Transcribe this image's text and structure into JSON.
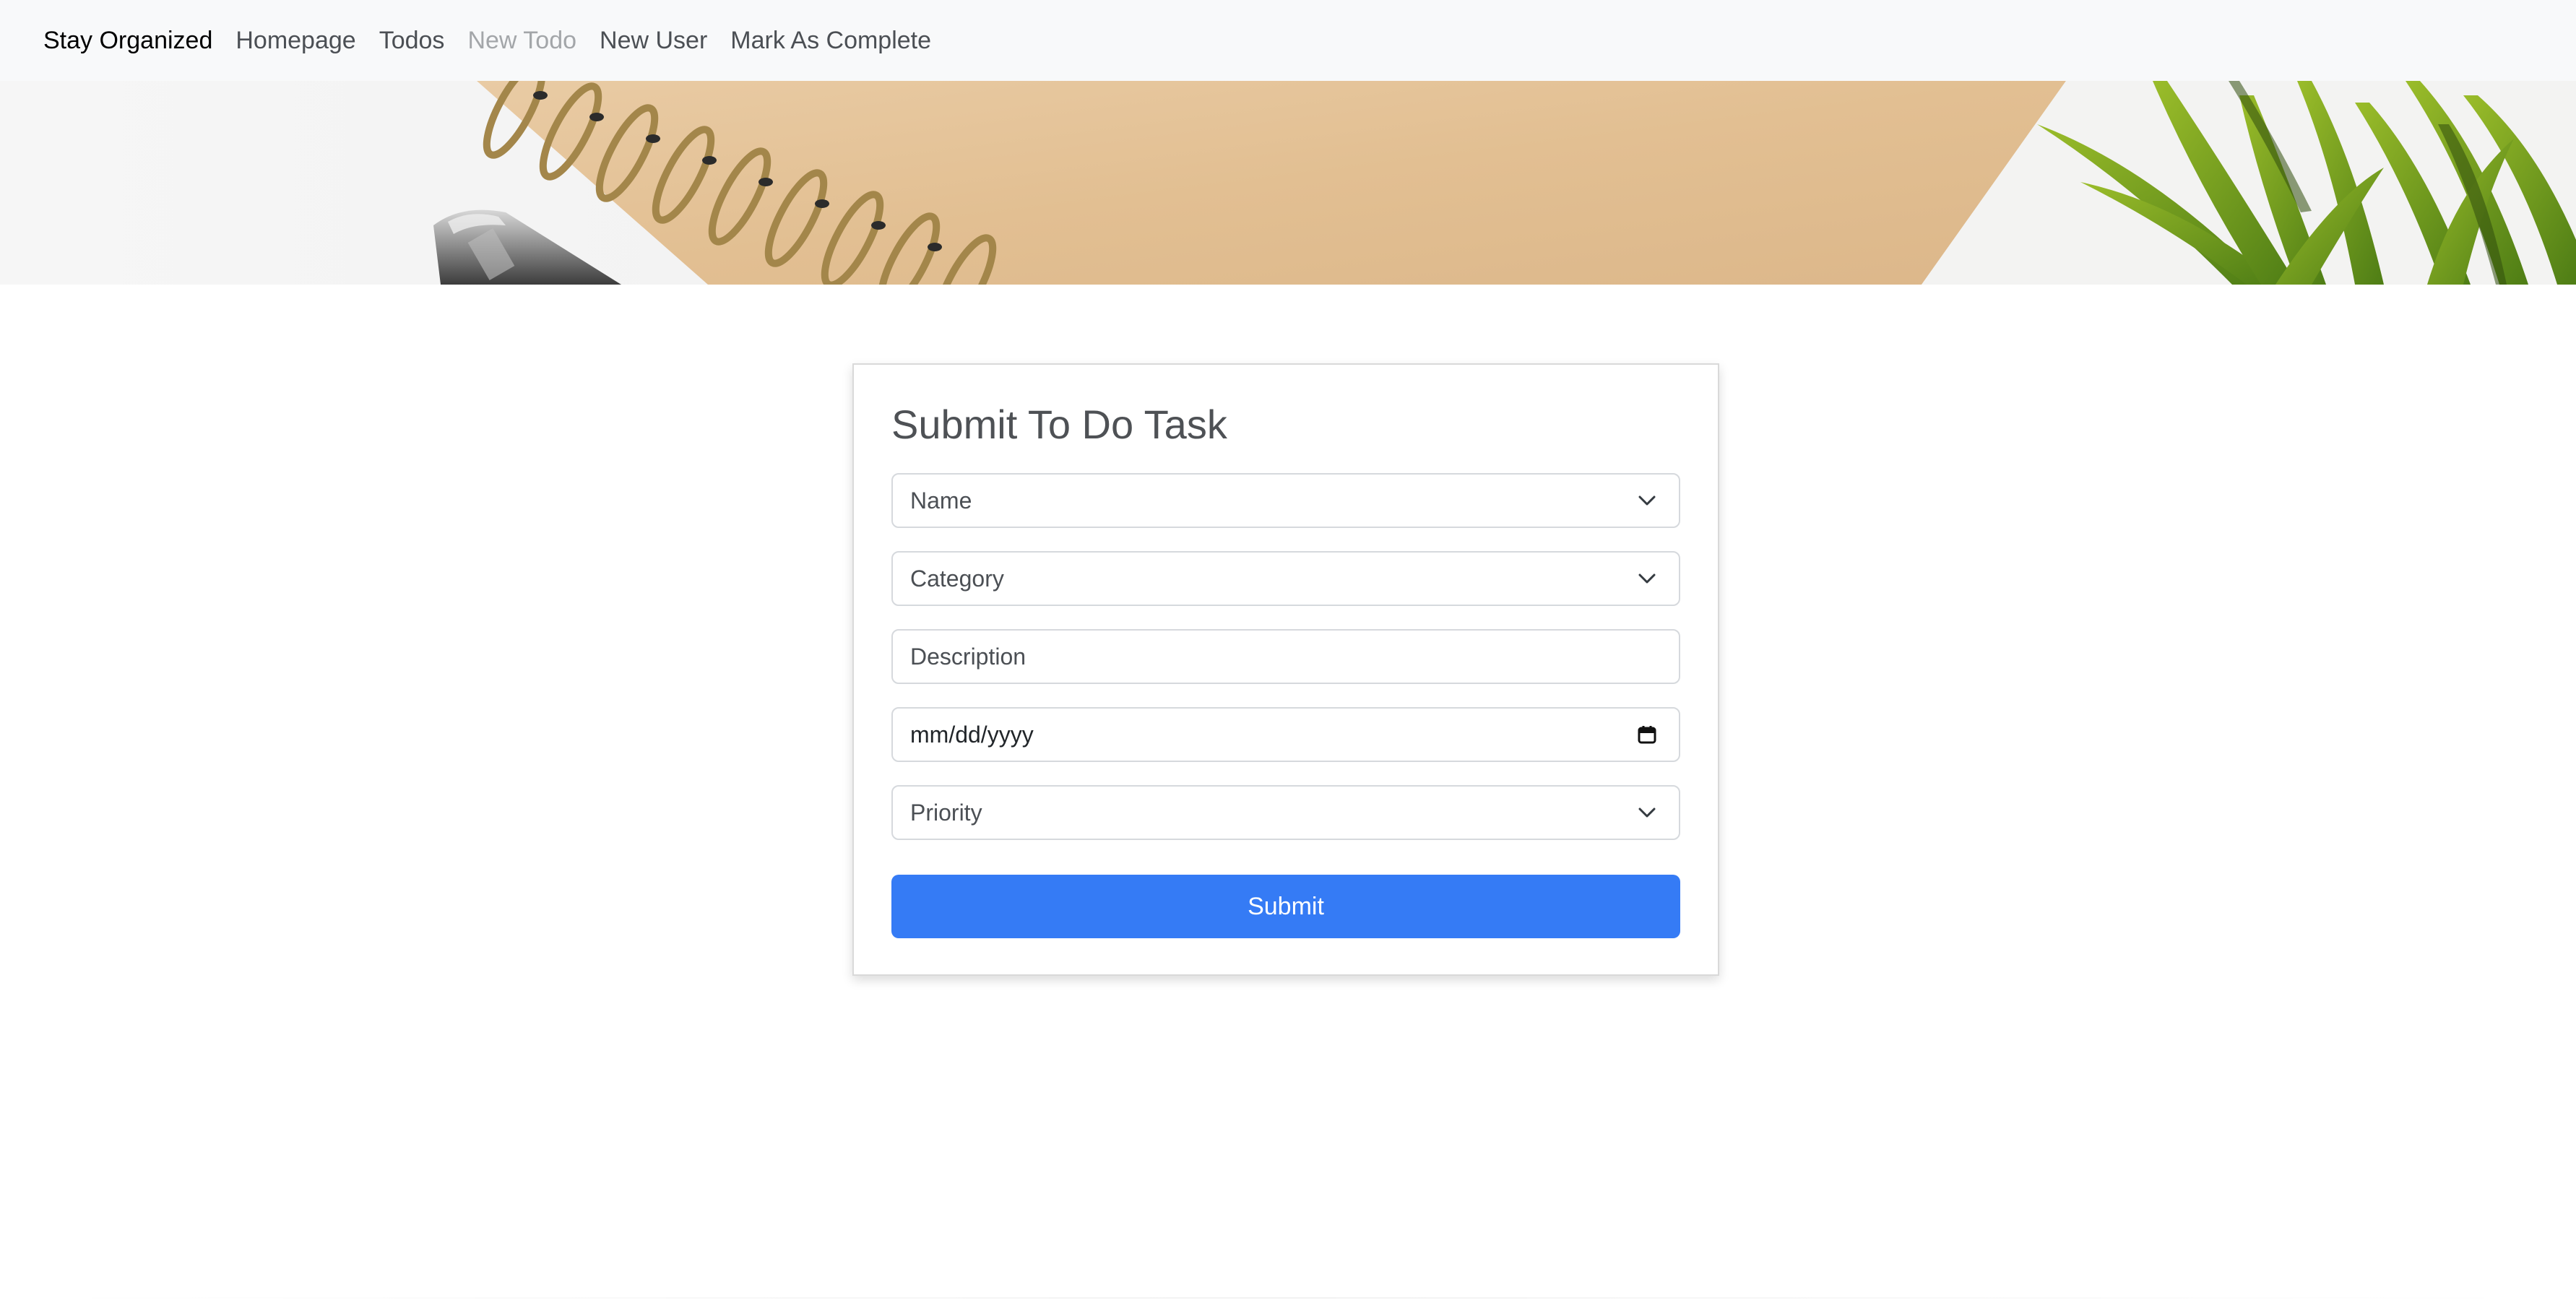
{
  "navbar": {
    "brand": "Stay Organized",
    "links": [
      {
        "label": "Homepage",
        "active": false
      },
      {
        "label": "Todos",
        "active": false
      },
      {
        "label": "New Todo",
        "active": true
      },
      {
        "label": "New User",
        "active": false
      },
      {
        "label": "Mark As Complete",
        "active": false
      }
    ]
  },
  "hero": {
    "image": "notebook-pen-plant-banner"
  },
  "form": {
    "title": "Submit To Do Task",
    "name_select": {
      "value": "Name",
      "icon": "chevron-down-icon"
    },
    "category_select": {
      "value": "Category",
      "icon": "chevron-down-icon"
    },
    "description_input": {
      "placeholder": "Description"
    },
    "date_input": {
      "placeholder": "mm/dd/yyyy",
      "icon": "calendar-icon"
    },
    "priority_select": {
      "value": "Priority",
      "icon": "chevron-down-icon"
    },
    "submit_label": "Submit"
  },
  "colors": {
    "navbar_bg": "#f8f9fa",
    "primary": "#357bf5",
    "inactive_link": "#a3a6a9"
  }
}
